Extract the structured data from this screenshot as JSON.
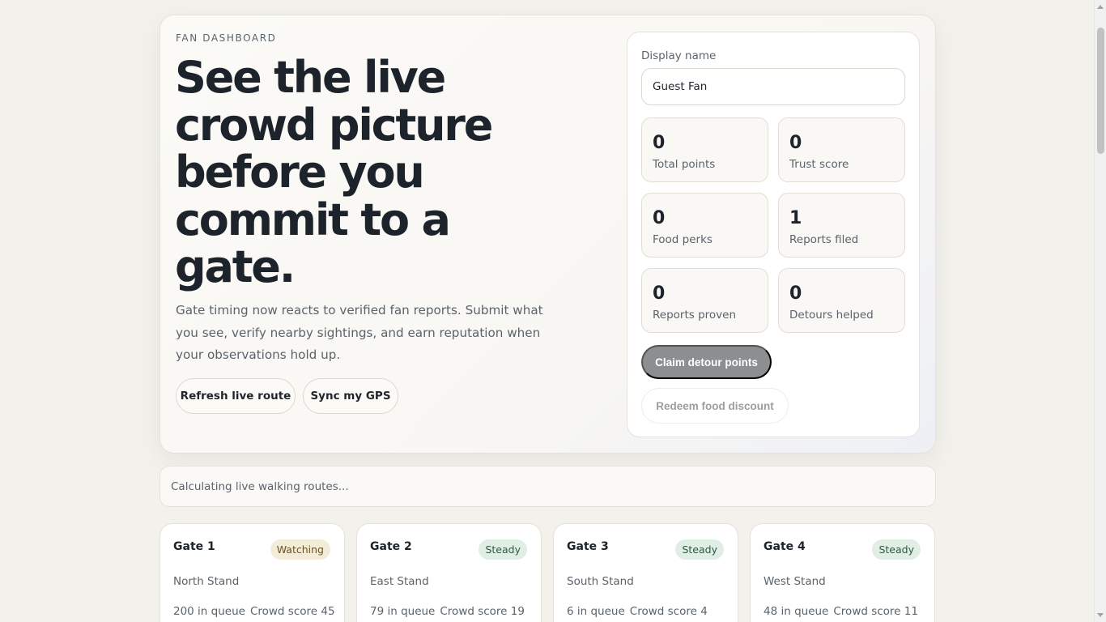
{
  "hero": {
    "eyebrow": "FAN DASHBOARD",
    "headline": "See the live crowd picture before you commit to a gate.",
    "lede": "Gate timing now reacts to verified fan reports. Submit what you see, verify nearby sightings, and earn reputation when your observations hold up.",
    "refresh_label": "Refresh live route",
    "gps_label": "Sync my GPS"
  },
  "panel": {
    "display_name_label": "Display name",
    "display_name_value": "Guest Fan",
    "stats": [
      {
        "value": "0",
        "label": "Total points"
      },
      {
        "value": "0",
        "label": "Trust score"
      },
      {
        "value": "0",
        "label": "Food perks"
      },
      {
        "value": "1",
        "label": "Reports filed"
      },
      {
        "value": "0",
        "label": "Reports proven"
      },
      {
        "value": "0",
        "label": "Detours helped"
      }
    ],
    "claim_label": "Claim detour points",
    "redeem_label": "Redeem food discount"
  },
  "route_status": "Calculating live walking routes...",
  "gates": [
    {
      "name": "Gate 1",
      "status": "Watching",
      "stand": "North Stand",
      "queue": "200 in queue",
      "crowd": "Crowd score 45"
    },
    {
      "name": "Gate 2",
      "status": "Steady",
      "stand": "East Stand",
      "queue": "79 in queue",
      "crowd": "Crowd score 19"
    },
    {
      "name": "Gate 3",
      "status": "Steady",
      "stand": "South Stand",
      "queue": "6 in queue",
      "crowd": "Crowd score 4"
    },
    {
      "name": "Gate 4",
      "status": "Steady",
      "stand": "West Stand",
      "queue": "48 in queue",
      "crowd": "Crowd score 11"
    }
  ]
}
